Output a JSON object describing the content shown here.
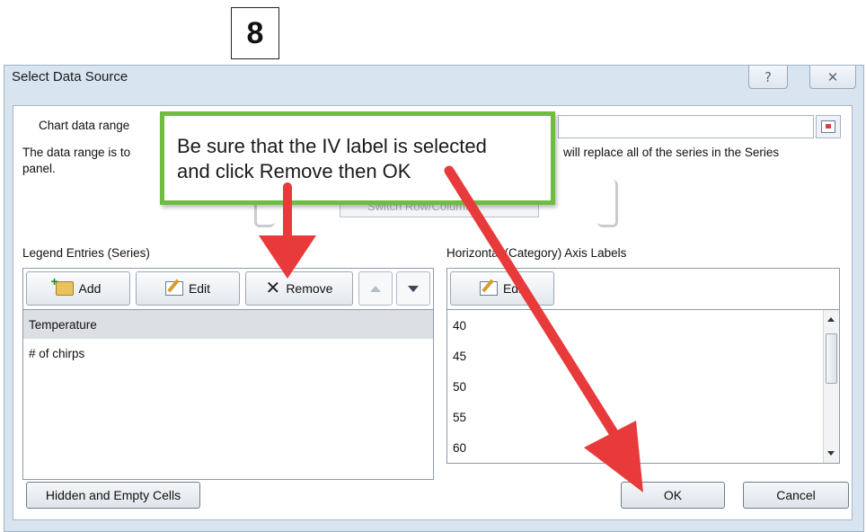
{
  "step_number": "8",
  "dialog": {
    "title": "Select Data Source",
    "help_icon": "question-icon",
    "close_icon": "close-icon",
    "chart_data_range_label": "Chart data range",
    "info_text_left": "The data range is to",
    "info_text_right": "will replace all of the series in the Series",
    "info_text_line2": "panel.",
    "switch_label": "Switch Row/Column"
  },
  "legend": {
    "heading": "Legend Entries (Series)",
    "add_label": "Add",
    "edit_label": "Edit",
    "remove_label": "Remove",
    "items": [
      {
        "label": "Temperature",
        "selected": true
      },
      {
        "label": "# of chirps",
        "selected": false
      }
    ]
  },
  "axis": {
    "heading": "Horizontal (Category) Axis Labels",
    "edit_label": "Edit",
    "values": [
      "40",
      "45",
      "50",
      "55",
      "60"
    ]
  },
  "footer": {
    "hidden_cells_label": "Hidden and Empty Cells",
    "ok_label": "OK",
    "cancel_label": "Cancel"
  },
  "callout": {
    "line1": "Be sure that the IV label is selected",
    "line2": "and click Remove then OK"
  },
  "colors": {
    "arrow": "#e83a3a",
    "callout_border": "#6fbd3f",
    "dialog_bg": "#d9e4f1"
  }
}
